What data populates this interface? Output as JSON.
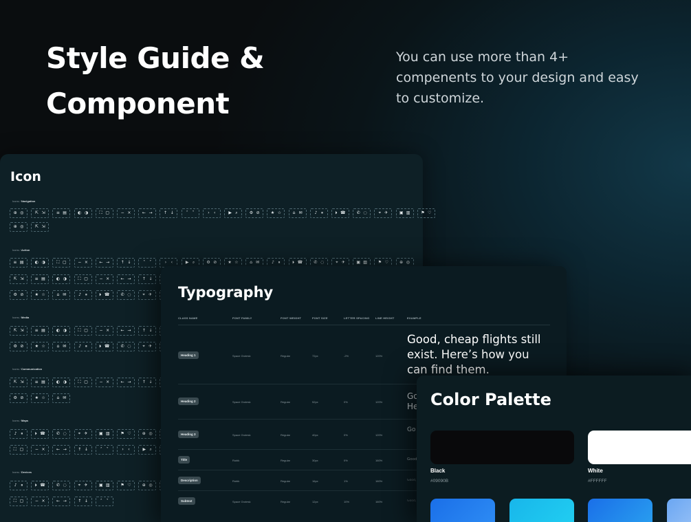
{
  "hero": {
    "title_line1": "Style Guide &",
    "title_line2": "Component",
    "subtitle": "You can use more than 4+ compenents to your design and easy to customize."
  },
  "icon_card": {
    "title": "Icon",
    "sections": [
      {
        "prefix": "Icons / ",
        "name": "Navigation"
      },
      {
        "prefix": "Icons / ",
        "name": "Action"
      },
      {
        "prefix": "Icons / ",
        "name": "Media"
      },
      {
        "prefix": "Icons / ",
        "name": "Communication"
      },
      {
        "prefix": "Icons / ",
        "name": "Maps"
      },
      {
        "prefix": "Icons / ",
        "name": "Devices"
      }
    ]
  },
  "typography": {
    "title": "Typography",
    "headers": [
      "CLASS NAME",
      "FONT FAMILY",
      "FONT WEIGHT",
      "FONT SIZE",
      "LETTER SPACING",
      "LINE HEIGHT",
      "EXAMPLE"
    ],
    "rows": [
      {
        "class_name": "Heading 1",
        "family": "Space Grotesk",
        "weight": "Regular",
        "size": "72px",
        "spacing": "-2%",
        "line_height": "120%",
        "example": "Good, cheap flights still exist. Here’s how you can find them."
      },
      {
        "class_name": "Heading 2",
        "family": "Space Grotesk",
        "weight": "Regular",
        "size": "52px",
        "spacing": "0%",
        "line_height": "120%",
        "example": "Go He"
      },
      {
        "class_name": "Heading 3",
        "family": "Space Grotesk",
        "weight": "Regular",
        "size": "40px",
        "spacing": "0%",
        "line_height": "120%",
        "example": "Go Ho"
      },
      {
        "class_name": "Title",
        "family": "Rubik",
        "weight": "Regular",
        "size": "30px",
        "spacing": "0%",
        "line_height": "160%",
        "example": "Good,"
      },
      {
        "class_name": "Description",
        "family": "Rubik",
        "weight": "Regular",
        "size": "16px",
        "spacing": "1%",
        "line_height": "160%",
        "example": "Good, c"
      },
      {
        "class_name": "Subtext",
        "family": "Space Grotesk",
        "weight": "Regular",
        "size": "12px",
        "spacing": "10%",
        "line_height": "160%",
        "example": "Good, ch"
      }
    ]
  },
  "palette": {
    "title": "Color Palette",
    "swatches": [
      {
        "name": "Black",
        "hex": "#09090B",
        "color": "#09090b"
      },
      {
        "name": "White",
        "hex": "#FFFFFF",
        "color": "#ffffff"
      }
    ],
    "gradients": [
      "#1f7df0",
      "#1ac3ee",
      "#2080f0",
      "#7ab0f5"
    ]
  }
}
